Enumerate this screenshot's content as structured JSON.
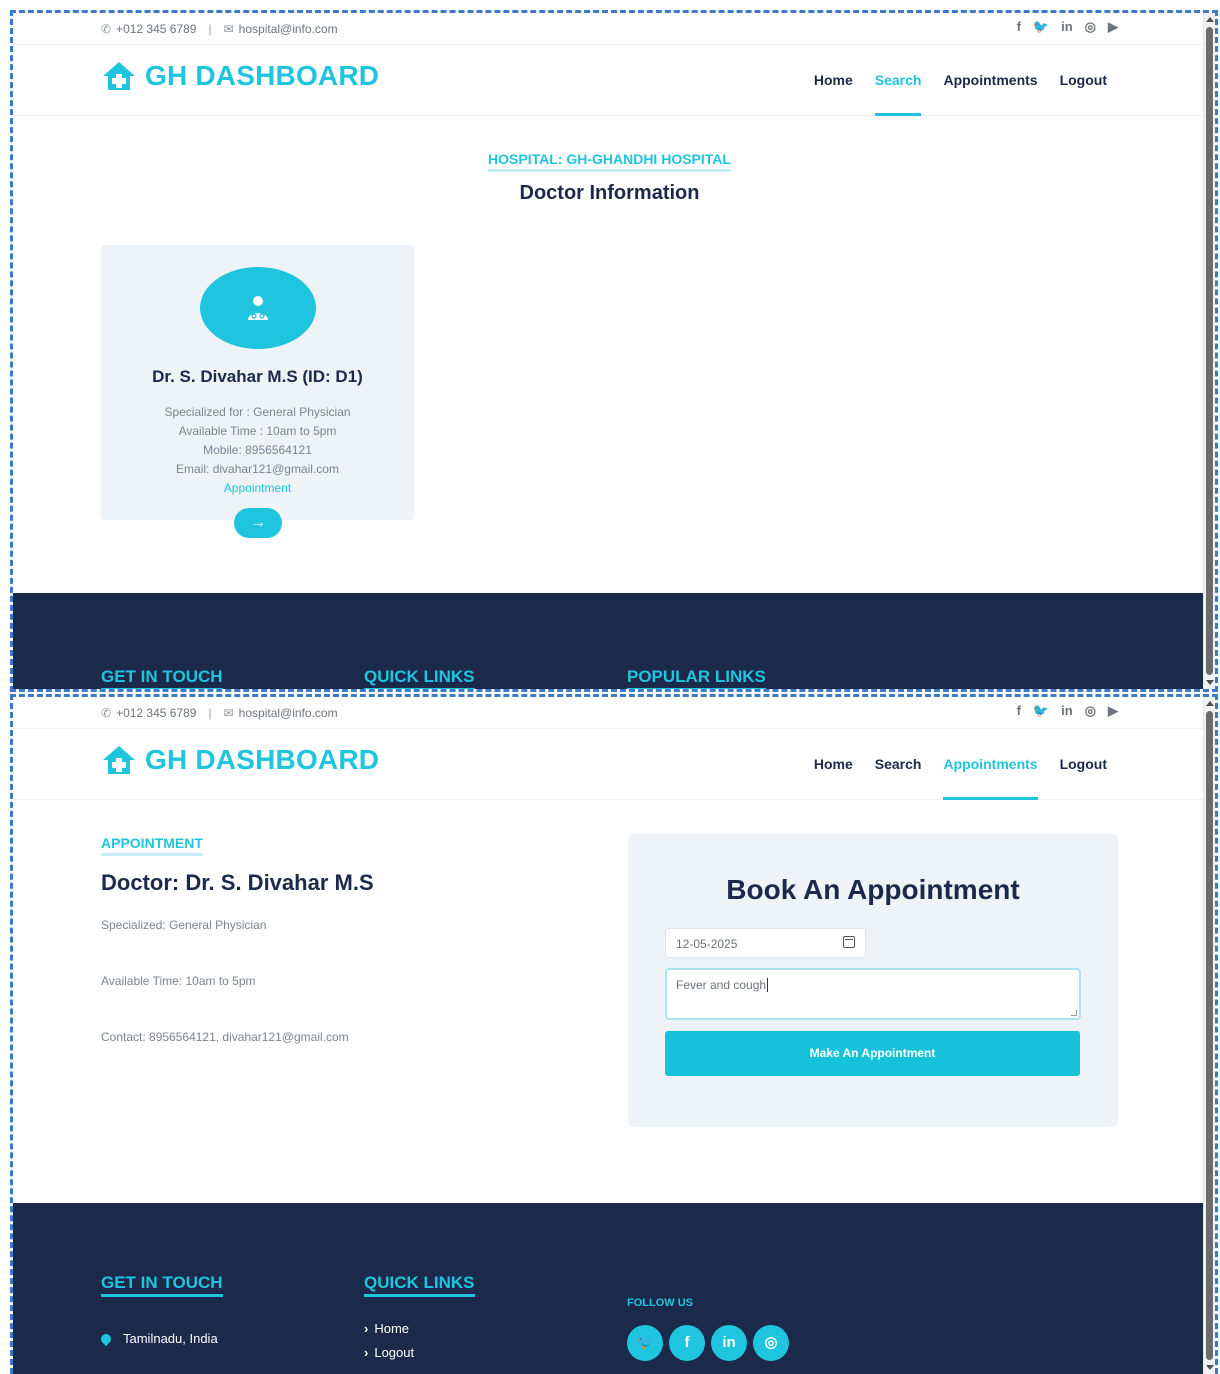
{
  "topbar": {
    "phone": "+012 345 6789",
    "separator": "|",
    "email": "hospital@info.com",
    "social_icons": [
      "facebook-icon",
      "twitter-icon",
      "linkedin-icon",
      "instagram-icon",
      "youtube-icon"
    ],
    "social_glyphs": [
      "f",
      "🐦",
      "in",
      "◎",
      "▶"
    ]
  },
  "brand": {
    "name": "GH DASHBOARD",
    "color": "#1fc5de"
  },
  "nav": {
    "home": "Home",
    "search": "Search",
    "appointments": "Appointments",
    "logout": "Logout"
  },
  "screen1": {
    "hospital_label": "HOSPITAL: GH-GHANDHI HOSPITAL",
    "heading": "Doctor Information",
    "doctor": {
      "name": "Dr. S. Divahar M.S (ID: D1)",
      "specialized": "Specialized for : General Physician",
      "available": "Available Time : 10am to 5pm",
      "mobile": "Mobile: 8956564121",
      "email": "Email: divahar121@gmail.com",
      "appointment_link": "Appointment",
      "arrow": "→"
    }
  },
  "screen2": {
    "sub_label": "APPOINTMENT",
    "doctor_title": "Doctor: Dr. S. Divahar M.S",
    "specialized": "Specialized: General Physician",
    "available": "Available Time: 10am to 5pm",
    "contact": "Contact: 8956564121, divahar121@gmail.com",
    "form": {
      "title": "Book An Appointment",
      "date_value": "12-05-2025",
      "reason_value": "Fever and cough",
      "submit_label": "Make An Appointment"
    }
  },
  "footer": {
    "get_in_touch": "GET IN TOUCH",
    "quick_links": "QUICK LINKS",
    "popular_links": "POPULAR LINKS",
    "follow_us": "FOLLOW US",
    "location": "Tamilnadu, India",
    "link_home": "Home",
    "link_logout": "Logout",
    "follow_icons": [
      "twitter-icon",
      "facebook-icon",
      "linkedin-icon",
      "instagram-icon"
    ]
  },
  "colors": {
    "accent": "#1fc5de",
    "navy": "#1b2a4a",
    "panel": "#eef3f7"
  }
}
